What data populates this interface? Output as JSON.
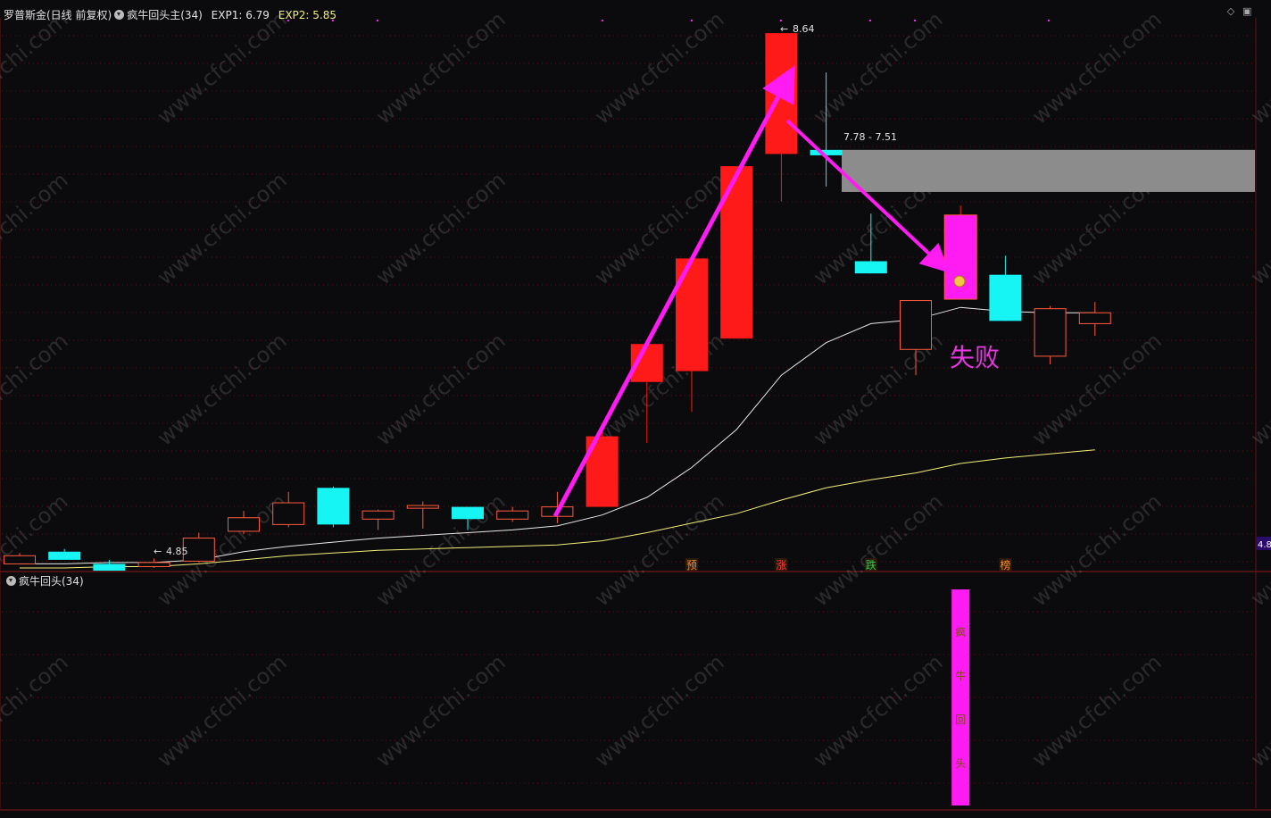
{
  "header": {
    "stock_name": "罗普斯金(日线 前复权)",
    "indicator_name": "疯牛回头主(34)",
    "exp1_label": "EXP1: 6.79",
    "exp2_label": "EXP2: 5.85"
  },
  "sub_header": {
    "indicator_name": "疯牛回头(34)"
  },
  "watermark": "www.cfchi.com",
  "colors": {
    "background": "#0b0b0d",
    "up": "#ff1a1a",
    "up_outline": "#ff5a3c",
    "down": "#17f4f4",
    "exp1_line": "#e8e8e8",
    "exp2_line": "#f4ef7a",
    "arrow": "#ff1cf2",
    "grid": "#5a1010",
    "signal_bar": "#ff1cf2",
    "zone": "#8c8c8c",
    "fail_text": "#e536e0"
  },
  "chart_data": {
    "type": "candlestick",
    "price_range": [
      4.7,
      8.7
    ],
    "candles": [
      {
        "o": 4.79,
        "h": 4.81,
        "l": 4.74,
        "c": 4.73,
        "filled": false
      },
      {
        "o": 4.82,
        "h": 4.84,
        "l": 4.77,
        "c": 4.76,
        "filled": true
      },
      {
        "o": 4.73,
        "h": 4.76,
        "l": 4.69,
        "c": 4.68,
        "filled": true
      },
      {
        "o": 4.74,
        "h": 4.77,
        "l": 4.7,
        "c": 4.71,
        "filled": false
      },
      {
        "o": 4.75,
        "h": 4.96,
        "l": 4.74,
        "c": 4.92,
        "filled": false
      },
      {
        "o": 4.97,
        "h": 5.12,
        "l": 4.95,
        "c": 5.07,
        "filled": false
      },
      {
        "o": 5.02,
        "h": 5.26,
        "l": 5.0,
        "c": 5.18,
        "filled": false
      },
      {
        "o": 5.29,
        "h": 5.3,
        "l": 5.0,
        "c": 5.02,
        "filled": true
      },
      {
        "o": 5.06,
        "h": 5.13,
        "l": 4.98,
        "c": 5.12,
        "filled": false
      },
      {
        "o": 5.14,
        "h": 5.19,
        "l": 4.99,
        "c": 5.16,
        "filled": false
      },
      {
        "o": 5.15,
        "h": 5.15,
        "l": 4.98,
        "c": 5.06,
        "filled": true
      },
      {
        "o": 5.06,
        "h": 5.15,
        "l": 5.04,
        "c": 5.12,
        "filled": false
      },
      {
        "o": 5.08,
        "h": 5.26,
        "l": 5.03,
        "c": 5.15,
        "filled": false
      },
      {
        "o": 5.15,
        "h": 5.71,
        "l": 5.15,
        "c": 5.67,
        "filled": true
      },
      {
        "o": 6.07,
        "h": 6.07,
        "l": 5.62,
        "c": 6.35,
        "filled": true
      },
      {
        "o": 6.15,
        "h": 6.98,
        "l": 5.85,
        "c": 6.98,
        "filled": true
      },
      {
        "o": 6.39,
        "h": 7.66,
        "l": 6.39,
        "c": 7.66,
        "filled": true
      },
      {
        "o": 7.75,
        "h": 8.64,
        "l": 7.4,
        "c": 8.64,
        "filled": true
      },
      {
        "o": 7.78,
        "h": 8.35,
        "l": 7.51,
        "c": 7.74,
        "filled": true
      },
      {
        "o": 6.96,
        "h": 7.31,
        "l": 6.87,
        "c": 6.87,
        "filled": true
      },
      {
        "o": 6.67,
        "h": 6.67,
        "l": 6.12,
        "c": 6.31,
        "filled": false
      },
      {
        "o": 6.68,
        "h": 7.37,
        "l": 6.68,
        "c": 7.3,
        "filled": true
      },
      {
        "o": 6.86,
        "h": 7.0,
        "l": 6.52,
        "c": 6.52,
        "filled": true
      },
      {
        "o": 6.61,
        "h": 6.63,
        "l": 6.2,
        "c": 6.26,
        "filled": false
      },
      {
        "o": 6.58,
        "h": 6.66,
        "l": 6.41,
        "c": 6.5,
        "filled": false
      }
    ],
    "exp1_line": [
      4.73,
      4.73,
      4.74,
      4.74,
      4.76,
      4.82,
      4.86,
      4.89,
      4.92,
      4.94,
      4.96,
      4.98,
      5.01,
      5.09,
      5.22,
      5.44,
      5.72,
      6.12,
      6.36,
      6.5,
      6.53,
      6.62,
      6.59,
      6.58,
      6.58
    ],
    "exp2_line": [
      4.7,
      4.7,
      4.71,
      4.71,
      4.73,
      4.76,
      4.79,
      4.81,
      4.83,
      4.84,
      4.85,
      4.86,
      4.87,
      4.9,
      4.96,
      5.03,
      5.1,
      5.2,
      5.29,
      5.35,
      5.4,
      5.47,
      5.51,
      5.54,
      5.57
    ],
    "annotations": {
      "high_label": "8.64",
      "low_label": "4.85",
      "range_label": "7.78 - 7.51",
      "fail_label": "失败",
      "right_price_label": "4.8",
      "signal_chars": [
        "疯",
        "牛",
        "回",
        "头"
      ],
      "bottom_markers": [
        {
          "index": 15,
          "text": "预",
          "color": "#ff8a2a"
        },
        {
          "index": 17,
          "text": "涨",
          "color": "#ff3b3b"
        },
        {
          "index": 19,
          "text": "跌",
          "color": "#27d24a"
        },
        {
          "index": 22,
          "text": "榜",
          "color": "#ff8a2a"
        }
      ],
      "signal_index": 21,
      "zone_range": [
        7.47,
        7.78
      ]
    }
  }
}
